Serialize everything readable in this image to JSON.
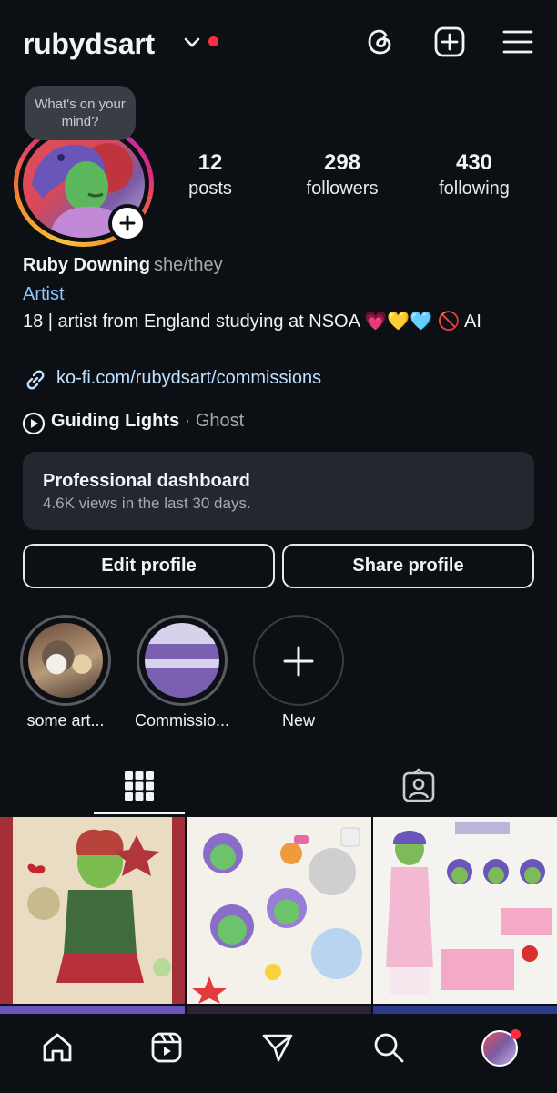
{
  "header": {
    "username": "rubydsart"
  },
  "avatar": {
    "thought_bubble": "What's on your mind?"
  },
  "stats": [
    {
      "number": "12",
      "label": "posts"
    },
    {
      "number": "298",
      "label": "followers"
    },
    {
      "number": "430",
      "label": "following"
    }
  ],
  "bio": {
    "name": "Ruby Downing",
    "pronouns": "she/they",
    "category": "Artist",
    "text": "18 | artist from England studying at NSOA 💗💛🩵 🚫 AI",
    "link": "ko-fi.com/rubydsart/commissions",
    "music_title": "Guiding Lights",
    "music_separator": " · ",
    "music_artist": "Ghost"
  },
  "dashboard": {
    "title": "Professional dashboard",
    "subtitle": "4.6K views in the last 30 days."
  },
  "buttons": {
    "edit": "Edit profile",
    "share": "Share profile"
  },
  "highlights": [
    {
      "label": "some art..."
    },
    {
      "label": "Commissio..."
    },
    {
      "label": "New"
    }
  ],
  "colors": {
    "background": "#0c0f14",
    "accent_link": "#8cc5ff",
    "notification": "#ff2d3f"
  },
  "icons": {
    "header": [
      "threads-icon",
      "create-icon",
      "menu-icon"
    ],
    "tabs": [
      "grid-icon",
      "tagged-icon"
    ],
    "nav": [
      "home-icon",
      "reels-icon",
      "send-icon",
      "search-icon",
      "profile-avatar"
    ]
  }
}
